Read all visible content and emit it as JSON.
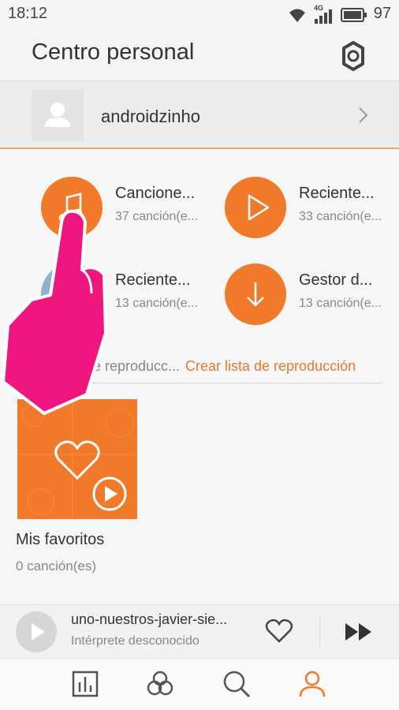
{
  "status": {
    "time": "18:12",
    "battery": "97",
    "network": "4G"
  },
  "header": {
    "title": "Centro personal"
  },
  "profile": {
    "username": "androidzinho"
  },
  "categories": [
    {
      "name": "Cancione...",
      "count": "37 canción(e...",
      "icon": "music-note-icon"
    },
    {
      "name": "Reciente...",
      "count": "33 canción(e...",
      "icon": "play-icon"
    },
    {
      "name": "Reciente...",
      "count": "13 canción(e...",
      "icon": "album-art"
    },
    {
      "name": "Gestor d...",
      "count": "13 canción(e...",
      "icon": "download-icon"
    }
  ],
  "playlists": {
    "label": "e reproducc...",
    "create": "Crear lista de reproducción"
  },
  "favorites": {
    "title": "Mis favoritos",
    "count": "0 canción(es)"
  },
  "player": {
    "track": "uno-nuestros-javier-sie...",
    "artist": "Intérprete desconocido"
  },
  "nav": [
    "chart-icon",
    "circles-icon",
    "search-icon",
    "person-icon"
  ],
  "colors": {
    "accent": "#f07a29",
    "touch_overlay": "#f0167f"
  }
}
